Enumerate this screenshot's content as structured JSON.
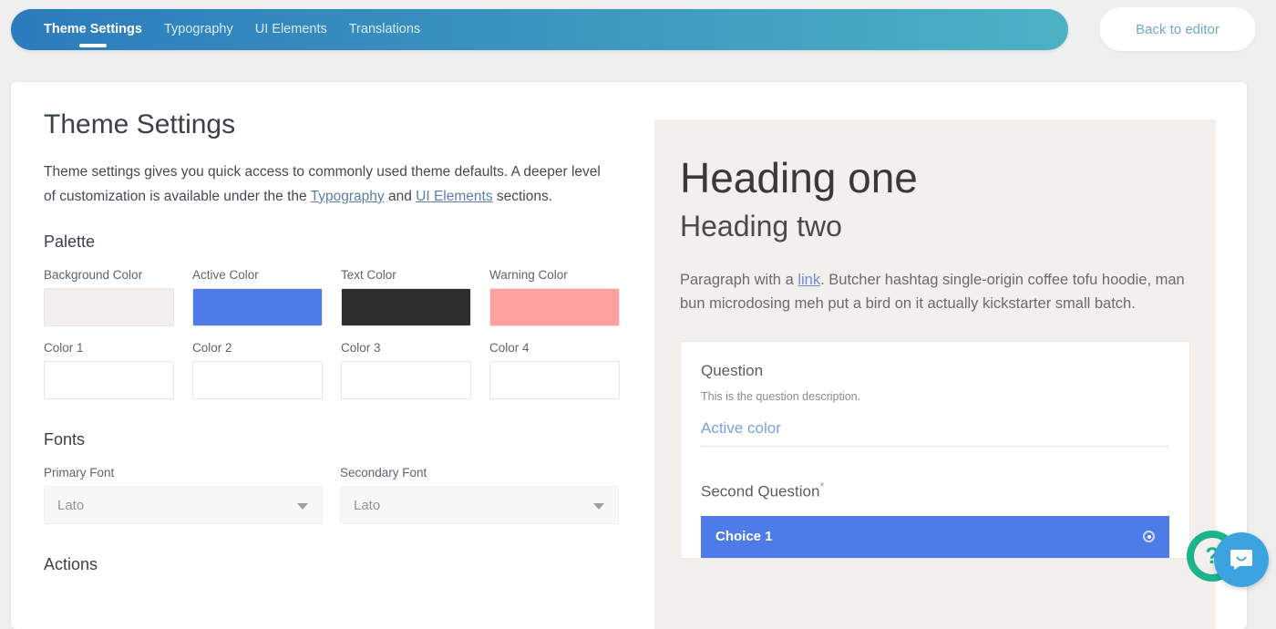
{
  "topbar": {
    "tabs": [
      {
        "label": "Theme Settings",
        "active": true
      },
      {
        "label": "Typography",
        "active": false
      },
      {
        "label": "UI Elements",
        "active": false
      },
      {
        "label": "Translations",
        "active": false
      }
    ],
    "back_button": "Back to editor",
    "gradient_start": "#2c7cbd",
    "gradient_end": "#4cb2c4"
  },
  "settings": {
    "title": "Theme Settings",
    "intro_part1": "Theme settings gives you quick access to commonly used theme defaults. A deeper level of customization is available under the the ",
    "intro_link1": "Typography",
    "intro_mid": " and ",
    "intro_link2": "UI Elements",
    "intro_part2": " sections.",
    "palette_heading": "Palette",
    "fonts_heading": "Fonts",
    "actions_heading": "Actions",
    "swatches": [
      {
        "label": "Background Color",
        "color": "#f2efec"
      },
      {
        "label": "Active Color",
        "color": "#4d7ce8"
      },
      {
        "label": "Text Color",
        "color": "#2e2e2e"
      },
      {
        "label": "Warning Color",
        "color": "#ffa0a0"
      },
      {
        "label": "Color 1",
        "color": ""
      },
      {
        "label": "Color 2",
        "color": ""
      },
      {
        "label": "Color 3",
        "color": ""
      },
      {
        "label": "Color 4",
        "color": ""
      }
    ],
    "fonts": [
      {
        "label": "Primary Font",
        "value": "Lato"
      },
      {
        "label": "Secondary Font",
        "value": "Lato"
      }
    ]
  },
  "preview": {
    "background": "#f2efec",
    "heading_one": "Heading one",
    "heading_two": "Heading two",
    "paragraph_pre": "Paragraph with a ",
    "paragraph_link": "link",
    "paragraph_post": ". Butcher hashtag single-origin coffee tofu hoodie, man bun microdosing meh put a bird on it actually kickstarter small batch.",
    "question": {
      "title": "Question",
      "description": "This is the question description.",
      "input_value": "Active color"
    },
    "question2": {
      "title": "Second Question",
      "required_mark": "*",
      "choice": "Choice 1"
    }
  },
  "widgets": {
    "help_glyph": "?",
    "help_color": "#1cb48d",
    "chat_color": "#3ba4e0"
  }
}
